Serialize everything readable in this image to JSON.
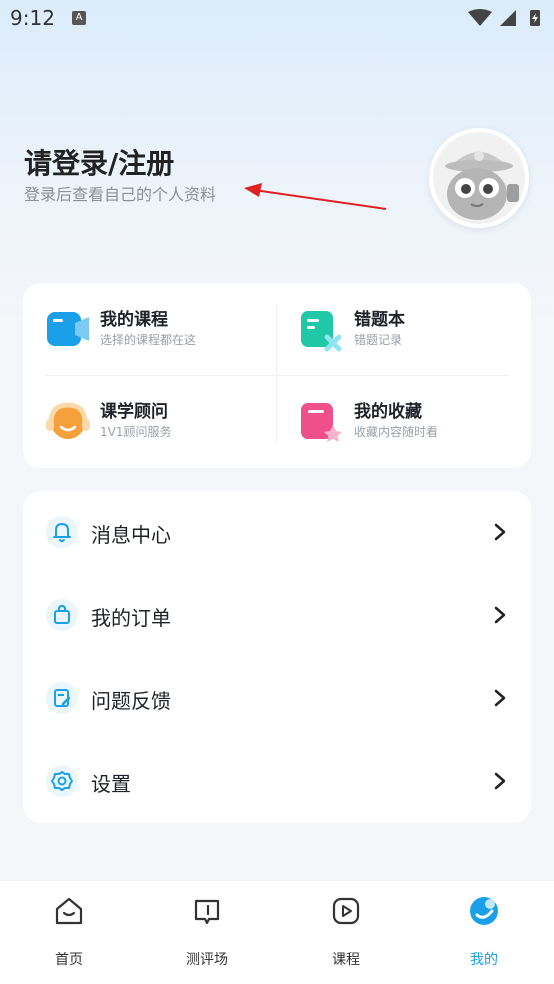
{
  "status_bar": {
    "time": "9:12",
    "badge": "A"
  },
  "profile": {
    "login_title": "请登录/注册",
    "login_subtitle": "登录后查看自己的个人资料"
  },
  "services": [
    {
      "title": "我的课程",
      "desc": "选择的课程都在这",
      "icon": "video-course-icon",
      "color": "#1aa0e8"
    },
    {
      "title": "错题本",
      "desc": "错题记录",
      "icon": "mistake-book-icon",
      "color": "#20c8a8"
    },
    {
      "title": "课学顾问",
      "desc": "1V1顾问服务",
      "icon": "advisor-headset-icon",
      "color": "#f5a03a"
    },
    {
      "title": "我的收藏",
      "desc": "收藏内容随时看",
      "icon": "favorites-icon",
      "color": "#f0508a"
    }
  ],
  "menu": [
    {
      "label": "消息中心",
      "icon": "bell-icon"
    },
    {
      "label": "我的订单",
      "icon": "shopping-bag-icon"
    },
    {
      "label": "问题反馈",
      "icon": "feedback-edit-icon"
    },
    {
      "label": "设置",
      "icon": "gear-icon"
    }
  ],
  "tabs": [
    {
      "label": "首页",
      "icon": "home-icon",
      "active": false
    },
    {
      "label": "测评场",
      "icon": "quiz-icon",
      "active": false
    },
    {
      "label": "课程",
      "icon": "play-icon",
      "active": false
    },
    {
      "label": "我的",
      "icon": "profile-icon",
      "active": true
    }
  ],
  "colors": {
    "accent": "#1aa0e8",
    "arrow": "#e02020"
  }
}
